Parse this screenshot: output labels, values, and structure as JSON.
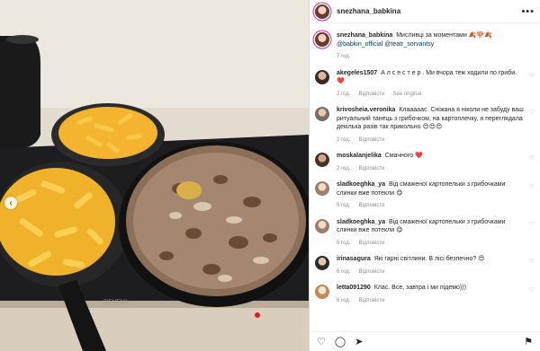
{
  "post": {
    "author": "snezhana_babkina",
    "more_icon": "more-horizontal-icon",
    "caption": {
      "username": "snezhana_babkina",
      "text": "Мисливці за моментами",
      "emojis": "🍂🍄🍂",
      "mentions": "@babkin_official @teatr_sorvantsy",
      "time": "7 год."
    }
  },
  "comments": [
    {
      "username": "akegeles1507",
      "text": "А л с е с т е р . Ми вчора теж ходили по гриби.",
      "emoji": "❤️",
      "meta": [
        "2 год.",
        "Відповісти",
        "See original"
      ]
    },
    {
      "username": "krivosheia.veronika",
      "text": "Клааааас. Сніжана я ніколи не забуду ваш ритуальний танець з грибочком, на картоплечку, я переглядала декілька разів так прикольно",
      "emoji": "😍😍😍",
      "meta": [
        "2 год.",
        "Відповісти"
      ]
    },
    {
      "username": "moskalanjelika",
      "text": "Смачного",
      "emoji": "❤️",
      "meta": [
        "2 год.",
        "Відповісти"
      ]
    },
    {
      "username": "sladkoeghka_ya",
      "text": "Від смаженої картопельки з грибочками слинки вже потекли",
      "emoji": "😋",
      "meta": [
        "5 год.",
        "Відповісти"
      ]
    },
    {
      "username": "sladkoeghka_ya",
      "text": "Від смаженої картопельки з грибочками слинки вже потекли",
      "emoji": "😋",
      "meta": [
        "5 год.",
        "Відповісти"
      ]
    },
    {
      "username": "irinasagura",
      "text": "Які гарні світлини. В лісі безпечно?",
      "emoji": "😍",
      "meta": [
        "6 год.",
        "Відповісти"
      ]
    },
    {
      "username": "letta091290",
      "text": "Клас. Все, завтра і ми підемо)))",
      "emoji": "",
      "meta": [
        "6 год.",
        "Відповісти"
      ]
    }
  ],
  "icons": {
    "like": "heart-icon",
    "comment": "comment-icon",
    "share": "send-icon",
    "save": "bookmark-icon",
    "carousel_prev": "chevron-left-icon"
  }
}
